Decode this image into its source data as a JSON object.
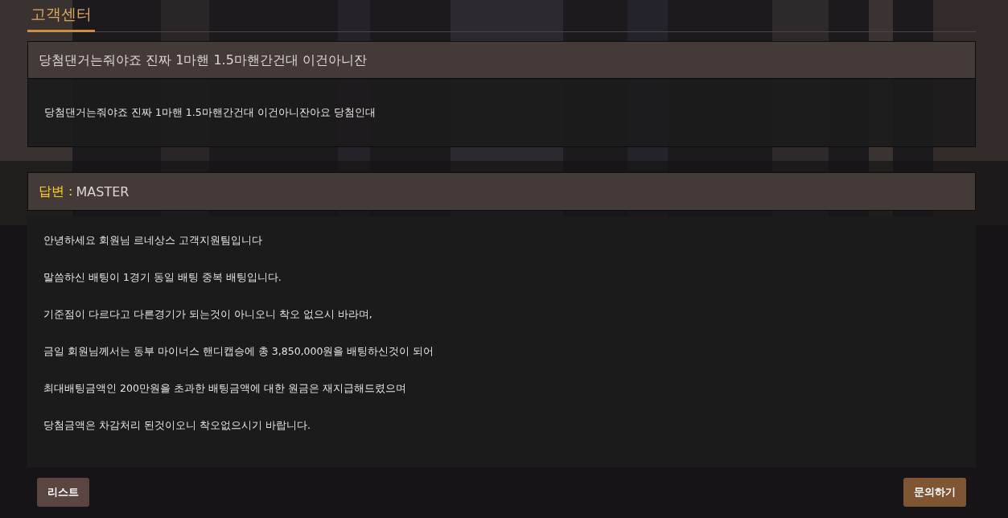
{
  "page_title": "고객센터",
  "question": {
    "title": "당첨댄거는줘야죠 진짜 1마핸 1.5마핸간건대 이건아니잔",
    "body": "당첨댄거는줘야죠 진짜 1마핸 1.5마핸간건대 이건아니잔아요 당첨인대"
  },
  "answer": {
    "label": "답변 :",
    "author": "MASTER",
    "paragraphs": [
      "안녕하세요 회원님 르네상스 고객지원팀입니다",
      "말씀하신 배팅이 1경기 동일 배팅 중복 배팅입니다.",
      "기준점이 다르다고 다른경기가 되는것이 아니오니 착오 없으시 바라며,",
      "금일 회원님께서는 동부 마이너스 핸디캡승에 총 3,850,000원을 배팅하신것이 되어",
      "최대배팅금액인 200만원을 초과한 배팅금액에 대한 원금은 재지급해드렸으며",
      "당첨금액은 차감처리 된것이오니 착오없으시기 바랍니다."
    ]
  },
  "buttons": [
    {
      "label": "리스트",
      "kind": "secondary"
    },
    {
      "label": "문의하기",
      "kind": "primary"
    }
  ]
}
